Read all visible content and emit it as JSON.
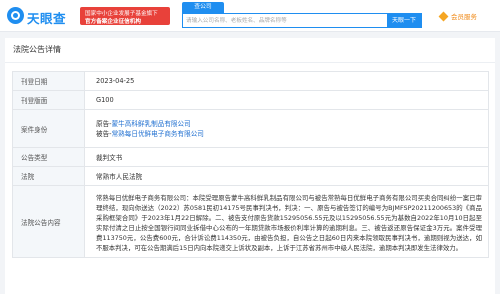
{
  "header": {
    "logo_text": "天眼查",
    "promo_line1": "国家中小企业发展子基金旗下",
    "promo_line2": "官方备案企业征信机构",
    "search_tab": "查公司",
    "search_placeholder": "请输入公司名称、老板姓名、品牌名称等",
    "search_button": "天眼一下",
    "user_label": "会员服务"
  },
  "page": {
    "title": "法院公告详情"
  },
  "details": [
    {
      "label": "刊登日期",
      "value": "2023-04-25"
    },
    {
      "label": "刊登版面",
      "value": "G100"
    },
    {
      "label": "公告类型",
      "value": "裁判文书"
    },
    {
      "label": "法院",
      "value": "常熟市人民法院"
    }
  ],
  "party": {
    "label": "案件身份",
    "line1_prefix": "原告-",
    "line1_company": "蒙牛高科鲜乳制品有限公司",
    "line2_prefix": "被告-",
    "line2_company": "常熟每日优鲜电子商务有限公司"
  },
  "content": {
    "label": "法院公告内容",
    "text": "常熟每日优鲜电子商务有限公司：本院受理原告蒙牛高科鲜乳制品有限公司与被告常熟每日优鲜电子商务有限公司买卖合同纠纷一案已审理终结，现向你送达（2022）苏0581民初14175号民事判决书，判决：一、原告与被告签订的编号为BJMFSP20211200653的《商品采购框架合同》于2023年1月22日解除。二、被告支付原告货款15295056.55元及以15295056.55元为基数自2022年10月10日起至实际付清之日止按全国银行间同业拆借中心公布的一年期贷款市场报价利率计算的逾期利息。三、被告返还原告保证金3万元。案件受理费113750元，公告费600元，合计诉讼费114350元，由被告负担，自公告之日起60日内来本院领取民事判决书，逾期则视为送达，如不服本判决，可在公告期满后15日内向本院递交上诉状及副本，上诉于江苏省苏州市中级人民法院，逾期本判决即发生法律效力。"
  }
}
